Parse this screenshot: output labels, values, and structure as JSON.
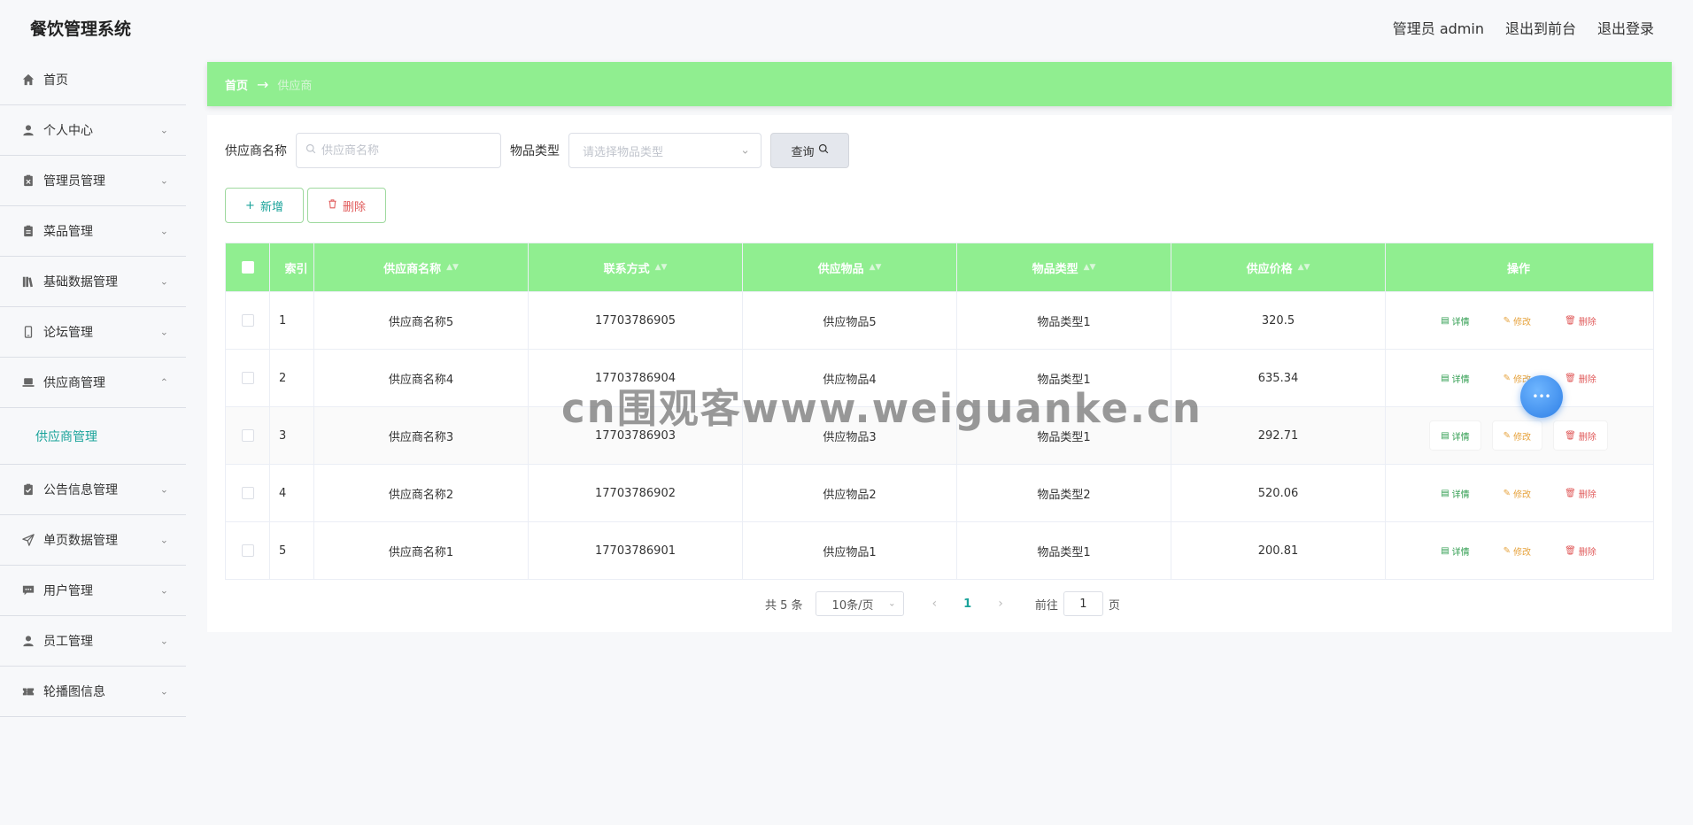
{
  "header": {
    "app_title": "餐饮管理系统",
    "admin_label": "管理员 admin",
    "exit_front": "退出到前台",
    "logout": "退出登录"
  },
  "sidebar": {
    "items": [
      {
        "label": "首页",
        "icon": "home-icon",
        "has_children": false
      },
      {
        "label": "个人中心",
        "icon": "user-icon",
        "has_children": true
      },
      {
        "label": "管理员管理",
        "icon": "clipboard-x-icon",
        "has_children": true
      },
      {
        "label": "菜品管理",
        "icon": "clipboard-icon",
        "has_children": true
      },
      {
        "label": "基础数据管理",
        "icon": "books-icon",
        "has_children": true
      },
      {
        "label": "论坛管理",
        "icon": "phone-icon",
        "has_children": true
      },
      {
        "label": "供应商管理",
        "icon": "laptop-icon",
        "has_children": true,
        "expanded": true
      },
      {
        "label": "公告信息管理",
        "icon": "clipboard-check-icon",
        "has_children": true
      },
      {
        "label": "单页数据管理",
        "icon": "send-icon",
        "has_children": true
      },
      {
        "label": "用户管理",
        "icon": "chat-icon",
        "has_children": true
      },
      {
        "label": "员工管理",
        "icon": "user-icon",
        "has_children": true
      },
      {
        "label": "轮播图信息",
        "icon": "ticket-icon",
        "has_children": true
      }
    ],
    "submenu": {
      "label": "供应商管理"
    }
  },
  "breadcrumb": {
    "home": "首页",
    "arrow": "→",
    "current": "供应商"
  },
  "search": {
    "name_label": "供应商名称",
    "name_placeholder": "供应商名称",
    "type_label": "物品类型",
    "type_placeholder": "请选择物品类型",
    "query_button": "查询"
  },
  "actions": {
    "add": "新增",
    "delete": "删除"
  },
  "table": {
    "columns": [
      "索引",
      "供应商名称",
      "联系方式",
      "供应物品",
      "物品类型",
      "供应价格",
      "操作"
    ],
    "rows": [
      {
        "index": "1",
        "name": "供应商名称5",
        "phone": "17703786905",
        "item": "供应物品5",
        "type": "物品类型1",
        "price": "320.5"
      },
      {
        "index": "2",
        "name": "供应商名称4",
        "phone": "17703786904",
        "item": "供应物品4",
        "type": "物品类型1",
        "price": "635.34"
      },
      {
        "index": "3",
        "name": "供应商名称3",
        "phone": "17703786903",
        "item": "供应物品3",
        "type": "物品类型1",
        "price": "292.71"
      },
      {
        "index": "4",
        "name": "供应商名称2",
        "phone": "17703786902",
        "item": "供应物品2",
        "type": "物品类型2",
        "price": "520.06"
      },
      {
        "index": "5",
        "name": "供应商名称1",
        "phone": "17703786901",
        "item": "供应物品1",
        "type": "物品类型1",
        "price": "200.81"
      }
    ],
    "op_labels": {
      "detail": "详情",
      "edit": "修改",
      "delete": "删除"
    }
  },
  "pagination": {
    "total": "共 5 条",
    "page_size": "10条/页",
    "current_page": "1",
    "goto_label": "前往",
    "goto_value": "1",
    "page_suffix": "页"
  },
  "watermark": "cn围观客www.weiguanke.cn",
  "colors": {
    "accent_green": "#90ee90",
    "teal": "#1aa39a",
    "danger": "#e05a5a",
    "warning": "#e6a23c"
  }
}
